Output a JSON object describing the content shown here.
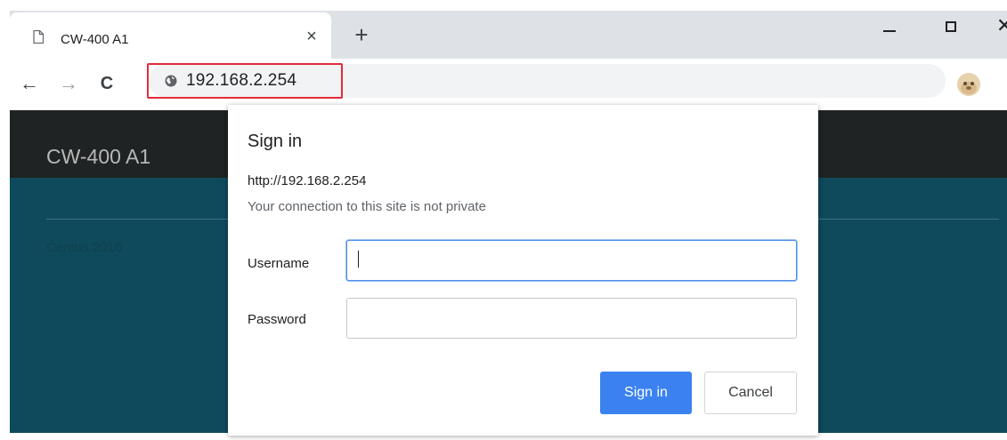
{
  "browser": {
    "tab": {
      "title": "CW-400 A1",
      "close_glyph": "×",
      "icon": "page-icon"
    },
    "new_tab_glyph": "+",
    "window_controls": {
      "minimize_icon": "minimize-icon",
      "maximize_icon": "maximize-icon",
      "close_glyph": "✕"
    },
    "nav": {
      "back_glyph": "←",
      "forward_glyph": "→",
      "reload_glyph": "C"
    },
    "address": {
      "url": "192.168.2.254",
      "icon": "globe-icon",
      "highlight_color": "#e32b3b"
    },
    "profile_icon": "avatar-icon"
  },
  "page": {
    "title": "CW-400 A1",
    "footer": "Centos 2016",
    "colors": {
      "header": "#202323",
      "body": "#0e4a5c"
    }
  },
  "dialog": {
    "title": "Sign in",
    "url": "http://192.168.2.254",
    "warning": "Your connection to this site is not private",
    "username_label": "Username",
    "username_value": "",
    "password_label": "Password",
    "password_value": "",
    "sign_in_label": "Sign in",
    "cancel_label": "Cancel",
    "colors": {
      "primary": "#3b82f0",
      "focus": "#4a8de8"
    }
  }
}
